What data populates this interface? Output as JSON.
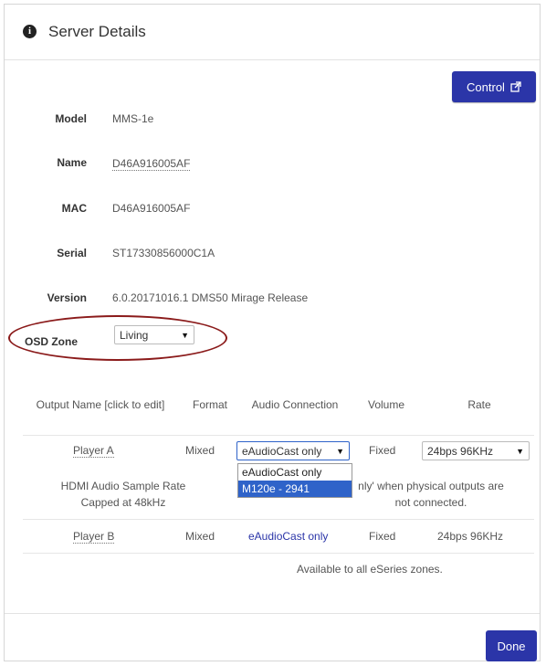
{
  "header": {
    "info_icon": "info-circle-icon",
    "title": "Server Details"
  },
  "control_button": {
    "label": "Control",
    "icon": "external-link-icon"
  },
  "details": {
    "model": {
      "label": "Model",
      "value": "MMS-1e"
    },
    "name": {
      "label": "Name",
      "value": "D46A916005AF"
    },
    "mac": {
      "label": "MAC",
      "value": "D46A916005AF"
    },
    "serial": {
      "label": "Serial",
      "value": "ST17330856000C1A"
    },
    "version": {
      "label": "Version",
      "value": "6.0.20171016.1 DMS50 Mirage Release"
    },
    "osd_zone": {
      "label": "OSD Zone",
      "value": "Living"
    }
  },
  "table": {
    "headers": {
      "output_name": "Output Name [click to edit]",
      "format": "Format",
      "audio_connection": "Audio Connection",
      "volume": "Volume",
      "rate": "Rate"
    },
    "player_a": {
      "name": "Player A",
      "format": "Mixed",
      "audio_connection": "eAudioCast only",
      "volume": "Fixed",
      "rate": "24bps 96KHz"
    },
    "player_a_note": {
      "left_line1": "HDMI Audio Sample Rate",
      "left_line2": "Capped at 48kHz",
      "right_line1": "nly' when physical outputs are",
      "right_line2": "not connected."
    },
    "player_b": {
      "name": "Player B",
      "format": "Mixed",
      "audio_connection": "eAudioCast only",
      "volume": "Fixed",
      "rate": "24bps 96KHz"
    },
    "footnote": "Available to all eSeries zones."
  },
  "audio_dropdown": {
    "options": [
      "eAudioCast only",
      "M120e - 2941"
    ],
    "highlighted": "M120e - 2941"
  },
  "done_button": {
    "label": "Done"
  },
  "colors": {
    "primary": "#2b35a8",
    "highlight": "#2f63c9",
    "annotation": "#8b1b1b"
  }
}
